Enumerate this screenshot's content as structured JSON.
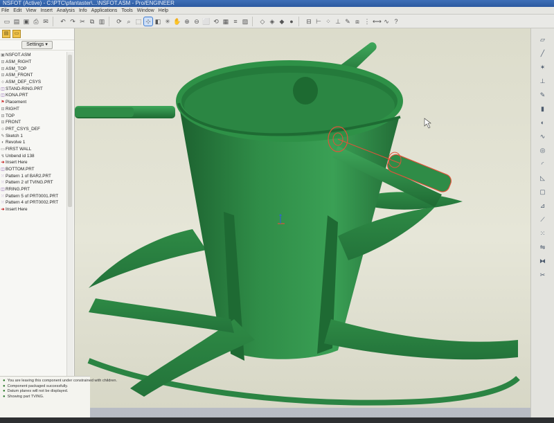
{
  "window": {
    "title": "NSFOT (Active) - C:\\PTC\\pfantaster\\...\\NSFOT.ASM - Pro/ENGINEER"
  },
  "menu": [
    "File",
    "Edit",
    "View",
    "Insert",
    "Analysis",
    "Info",
    "Applications",
    "Tools",
    "Window",
    "Help"
  ],
  "left_panel": {
    "settings_label": "Settings",
    "tree": [
      {
        "label": "NSFOT.ASM",
        "kind": "asm",
        "icon": "assembly-icon"
      },
      {
        "label": "ASM_RIGHT",
        "kind": "datum",
        "icon": "datum-plane-icon"
      },
      {
        "label": "ASM_TOP",
        "kind": "datum",
        "icon": "datum-plane-icon"
      },
      {
        "label": "ASM_FRONT",
        "kind": "datum",
        "icon": "datum-plane-icon"
      },
      {
        "label": "ASM_DEF_CSYS",
        "kind": "datum",
        "icon": "csys-icon"
      },
      {
        "label": "STAND-RING.PRT",
        "kind": "part",
        "icon": "part-icon"
      },
      {
        "label": "KONA.PRT",
        "kind": "part",
        "icon": "part-icon"
      },
      {
        "label": "Placement",
        "kind": "placement",
        "icon": "placement-icon"
      },
      {
        "label": "RIGHT",
        "kind": "datum",
        "icon": "datum-plane-icon"
      },
      {
        "label": "TOP",
        "kind": "datum",
        "icon": "datum-plane-icon"
      },
      {
        "label": "FRONT",
        "kind": "datum",
        "icon": "datum-plane-icon"
      },
      {
        "label": "PRT_CSYS_DEF",
        "kind": "datum",
        "icon": "csys-icon"
      },
      {
        "label": "Sketch 1",
        "kind": "feat",
        "icon": "sketch-icon"
      },
      {
        "label": "Revolve 1",
        "kind": "feat",
        "icon": "revolve-icon"
      },
      {
        "label": "FIRST WALL",
        "kind": "feat",
        "icon": "wall-icon"
      },
      {
        "label": "Unbend id 138",
        "kind": "feat",
        "icon": "unbend-icon"
      },
      {
        "label": "Insert Here",
        "kind": "insert",
        "icon": "insert-arrow-icon"
      },
      {
        "label": "BOTTOM.PRT",
        "kind": "part",
        "icon": "part-icon"
      },
      {
        "label": "Pattern 1 of BAR2.PRT",
        "kind": "part",
        "icon": "pattern-icon"
      },
      {
        "label": "Pattern 2 of TVING.PRT",
        "kind": "part",
        "icon": "pattern-icon"
      },
      {
        "label": "RRING.PRT",
        "kind": "part",
        "icon": "part-icon"
      },
      {
        "label": "Pattern 5 of PRT0001.PRT",
        "kind": "part",
        "icon": "pattern-icon"
      },
      {
        "label": "Pattern 4 of PRT0002.PRT",
        "kind": "part",
        "icon": "pattern-icon"
      },
      {
        "label": "Insert Here",
        "kind": "insert",
        "icon": "insert-arrow-icon"
      }
    ]
  },
  "messages": [
    "You are leaving this component under constrained with children.",
    "Component packaged successfully.",
    "Datum planes will not be displayed.",
    "Showing part TVING."
  ],
  "colors": {
    "model_green": "#2f8c47",
    "model_dark": "#1f6a33",
    "selection_red": "#e0533a",
    "viewport_bg": "#e2e2d2"
  }
}
